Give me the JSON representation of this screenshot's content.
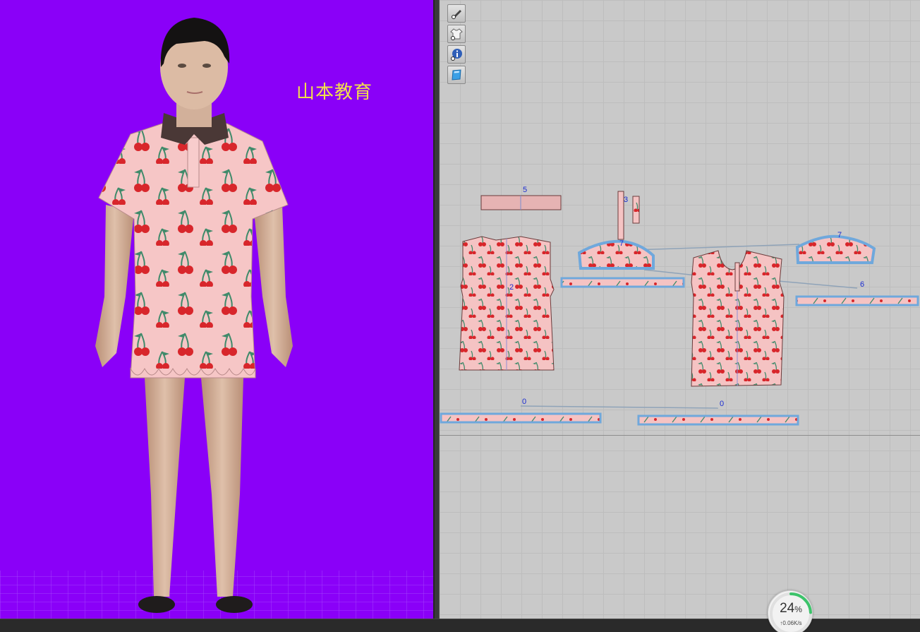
{
  "viewport3d": {
    "watermark": "山本教育",
    "background_color": "#8a00f8"
  },
  "pattern2d": {
    "piece_labels": {
      "back_body": "2",
      "placket_long": "3",
      "collar": "5",
      "sleeve_left": "7",
      "sleeve_right": "7",
      "sleeve_band": "6",
      "hem_band_left": "0",
      "hem_band_right": "0"
    }
  },
  "toolbar2d": {
    "tools": [
      {
        "icon": "show-pattern-icon"
      },
      {
        "icon": "show-garment-icon"
      },
      {
        "icon": "info-icon"
      },
      {
        "icon": "texture-icon"
      }
    ]
  },
  "progress": {
    "value": "24",
    "unit": "%",
    "fraction": 0.24,
    "speed": "↑0.06K/s"
  },
  "colors": {
    "fabric": "#f5c3c3",
    "cherry": "#d8262b",
    "leaf": "#3f8a6a",
    "seam_highlight": "#6fa8dc",
    "label_blue": "#1a2bd1"
  }
}
